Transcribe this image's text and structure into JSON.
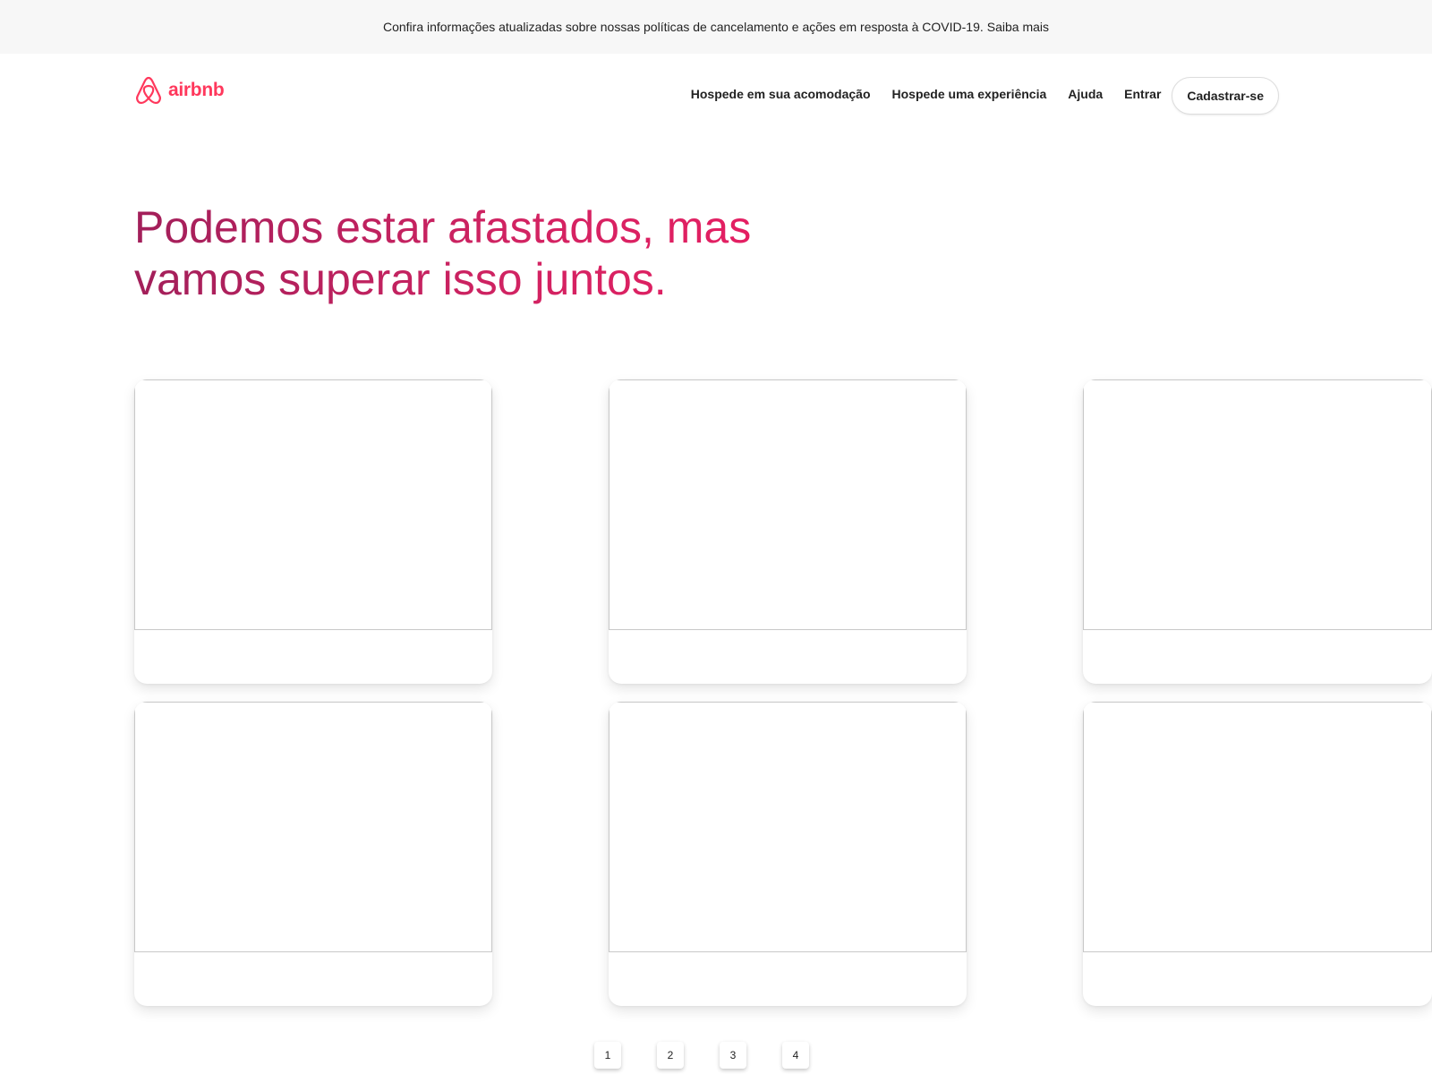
{
  "banner": {
    "text": "Confira informações atualizadas sobre nossas políticas de cancelamento e ações em resposta à COVID-19.",
    "link": "Saiba mais"
  },
  "header": {
    "logo_text": "airbnb",
    "brand_color": "#ff385c",
    "nav": {
      "host_home": "Hospede em sua acomodação",
      "host_experience": "Hospede uma experiência",
      "help": "Ajuda",
      "login": "Entrar",
      "signup": "Cadastrar-se"
    }
  },
  "hero": {
    "line1": "Podemos estar afastados, mas",
    "line2": "vamos superar isso juntos."
  },
  "pagination": {
    "pages": [
      "1",
      "2",
      "3",
      "4"
    ]
  }
}
